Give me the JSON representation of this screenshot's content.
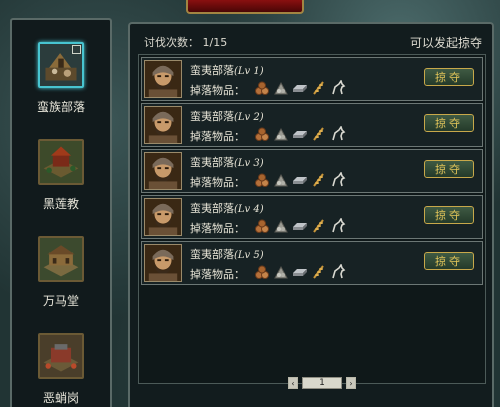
{
  "sidebar": {
    "tribes": [
      {
        "label": "蛮族部落",
        "icon": "barbarian-tribe-icon",
        "selected": true
      },
      {
        "label": "黑莲教",
        "icon": "black-lotus-sect-icon",
        "selected": false
      },
      {
        "label": "万马堂",
        "icon": "wanma-hall-icon",
        "selected": false
      },
      {
        "label": "恶蛸岗",
        "icon": "octopus-ridge-icon",
        "selected": false
      }
    ]
  },
  "panel": {
    "attack_count_label": "讨伐次数：",
    "attack_count_value": "1/15",
    "status_text": "可以发起掠夺"
  },
  "rows": [
    {
      "name": "蛮夷部落",
      "level": "(Lv 1)",
      "drops_label": "掉落物品：",
      "button": "掠夺"
    },
    {
      "name": "蛮夷部落",
      "level": "(Lv 2)",
      "drops_label": "掉落物品：",
      "button": "掠夺"
    },
    {
      "name": "蛮夷部落",
      "level": "(Lv 3)",
      "drops_label": "掉落物品：",
      "button": "掠夺"
    },
    {
      "name": "蛮夷部落",
      "level": "(Lv 4)",
      "drops_label": "掉落物品：",
      "button": "掠夺"
    },
    {
      "name": "蛮夷部落",
      "level": "(Lv 5)",
      "drops_label": "掉落物品：",
      "button": "掠夺"
    }
  ],
  "drop_icons": [
    "wood-logs-icon",
    "stone-pile-icon",
    "iron-ingot-icon",
    "grain-icon",
    "horse-icon"
  ],
  "pager": {
    "prev": "‹",
    "page": "1",
    "next": "›"
  },
  "colors": {
    "accent_gold": "#e3c65a",
    "selected_cyan": "#48c4d0",
    "button_green": "#2f4a35"
  }
}
